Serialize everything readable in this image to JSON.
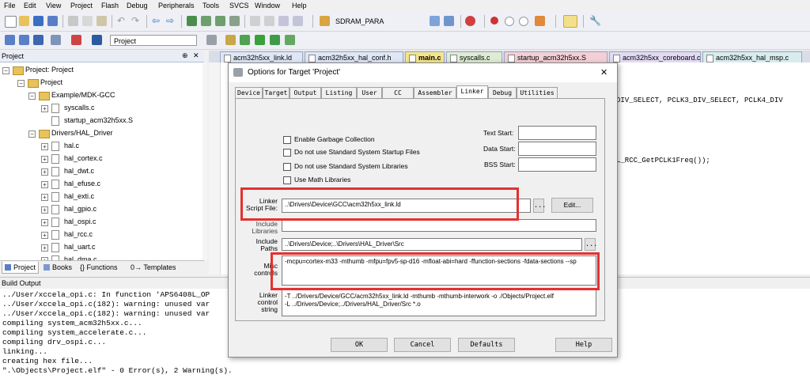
{
  "menu": [
    "File",
    "Edit",
    "View",
    "Project",
    "Flash",
    "Debug",
    "Peripherals",
    "Tools",
    "SVCS",
    "Window",
    "Help"
  ],
  "toolbar": {
    "target_combo": "SDRAM_PARA",
    "project_combo": "Project"
  },
  "project_pane": {
    "title": "Project",
    "tree": [
      {
        "label": "Project: Project",
        "level": 0,
        "kind": "root"
      },
      {
        "label": "Project",
        "level": 1,
        "kind": "folder"
      },
      {
        "label": "Example/MDK-GCC",
        "level": 2,
        "kind": "folder"
      },
      {
        "label": "syscalls.c",
        "level": 3,
        "kind": "file"
      },
      {
        "label": "startup_acm32h5xx.S",
        "level": 3,
        "kind": "file"
      },
      {
        "label": "Drivers/HAL_Driver",
        "level": 2,
        "kind": "folder"
      },
      {
        "label": "hal.c",
        "level": 3,
        "kind": "file"
      },
      {
        "label": "hal_cortex.c",
        "level": 3,
        "kind": "file"
      },
      {
        "label": "hal_dwt.c",
        "level": 3,
        "kind": "file"
      },
      {
        "label": "hal_efuse.c",
        "level": 3,
        "kind": "file"
      },
      {
        "label": "hal_exti.c",
        "level": 3,
        "kind": "file"
      },
      {
        "label": "hal_gpio.c",
        "level": 3,
        "kind": "file"
      },
      {
        "label": "hal_ospi.c",
        "level": 3,
        "kind": "file"
      },
      {
        "label": "hal_rcc.c",
        "level": 3,
        "kind": "file"
      },
      {
        "label": "hal_uart.c",
        "level": 3,
        "kind": "file"
      },
      {
        "label": "hal_dma.c",
        "level": 3,
        "kind": "file"
      }
    ],
    "tabs": [
      "Project",
      "Books",
      "{} Functions",
      "0→ Templates"
    ]
  },
  "editor": {
    "tabs": [
      {
        "label": "acm32h5xx_link.ld",
        "color": "#dfe6f5"
      },
      {
        "label": "acm32h5xx_hal_conf.h",
        "color": "#dfe6f5"
      },
      {
        "label": "main.c",
        "color": "#f3e58c"
      },
      {
        "label": "syscalls.c",
        "color": "#ddecd3"
      },
      {
        "label": "startup_acm32h5xx.S",
        "color": "#f3cfd6"
      },
      {
        "label": "acm32h5xx_coreboard.c",
        "color": "#e2daf2"
      },
      {
        "label": "acm32h5xx_hal_msp.c",
        "color": "#d7ecec"
      }
    ],
    "code_line1": "DIV_SELECT, PCLK3_DIV_SELECT, PCLK4_DIV",
    "code_line2": "L_RCC_GetPCLK1Freq());"
  },
  "build_output": {
    "title": "Build Output",
    "lines": [
      "../User/xccela_opi.c: In function 'APS6408L_OP",
      "../User/xccela_opi.c(182): warning: unused var",
      "../User/xccela_opi.c(182): warning: unused var",
      "compiling system_acm32h5xx.c...",
      "compiling system_accelerate.c...",
      "compiling drv_ospi.c...",
      "linking...",
      "creating hex file...",
      "\".\\Objects\\Project.elf\" - 0 Error(s), 2 Warning(s)."
    ]
  },
  "dialog": {
    "title": "Options for Target 'Project'",
    "close": "✕",
    "tabs": [
      "Device",
      "Target",
      "Output",
      "Listing",
      "User",
      "CC",
      "Assembler",
      "Linker",
      "Debug",
      "Utilities"
    ],
    "active_tab": "Linker",
    "checkboxes": [
      "Enable Garbage Collection",
      "Do not use Standard System Startup Files",
      "Do not use Standard System Libraries",
      "Use Math Libraries"
    ],
    "text_start_label": "Text Start:",
    "data_start_label": "Data Start:",
    "bss_start_label": "BSS Start:",
    "linker_script_label": "Linker Script File:",
    "linker_script_value": "..\\Drivers\\Device\\GCC\\acm32h5xx_link.ld",
    "browse_label": "...",
    "edit_label": "Edit...",
    "include_libraries_label": "Include Libraries",
    "include_paths_label": "Include Paths",
    "include_paths_value": "..\\Drivers\\Device;..\\Drivers\\HAL_Driver\\Src",
    "misc_controls_label": "Misc controls",
    "misc_controls_value": "-mcpu=cortex-m33 -mthumb -mfpu=fpv5-sp-d16 -mfloat-abi=hard -ffunction-sections -fdata-sections --sp",
    "linker_control_label": "Linker control string",
    "linker_control_line1": "-T ../Drivers/Device/GCC/acm32h5xx_link.ld -mthumb -mthumb-interwork -o ./Objects/Project.elf",
    "linker_control_line2": "-L ../Drivers/Device;../Drivers/HAL_Driver/Src *.o",
    "buttons": {
      "ok": "OK",
      "cancel": "Cancel",
      "defaults": "Defaults",
      "help": "Help"
    }
  }
}
